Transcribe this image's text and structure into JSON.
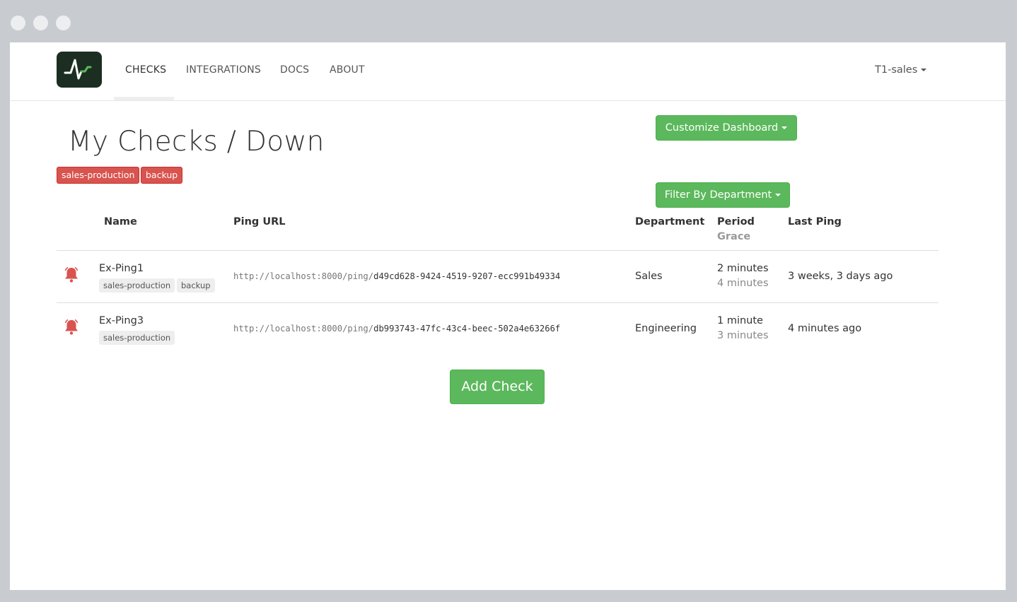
{
  "app": {
    "nav": {
      "links": [
        "CHECKS",
        "INTEGRATIONS",
        "DOCS",
        "ABOUT"
      ],
      "user": "T1-sales"
    }
  },
  "page": {
    "title": "My Checks / Down",
    "tags": [
      "sales-production",
      "backup"
    ],
    "customize_button": "Customize Dashboard",
    "filter_button": "Filter By Department",
    "add_button": "Add Check"
  },
  "table": {
    "headers": {
      "name": "Name",
      "ping_url": "Ping URL",
      "department": "Department",
      "period": "Period",
      "grace": "Grace",
      "last_ping": "Last Ping"
    },
    "rows": [
      {
        "status_icon": "bell-icon",
        "name": "Ex-Ping1",
        "tags": [
          "sales-production",
          "backup"
        ],
        "ping_base": "http://localhost:8000/ping/",
        "ping_code": "d49cd628-9424-4519-9207-ecc991b49334",
        "department": "Sales",
        "period": "2 minutes",
        "grace": "4 minutes",
        "last_ping": "3 weeks, 3 days ago"
      },
      {
        "status_icon": "bell-icon",
        "name": "Ex-Ping3",
        "tags": [
          "sales-production"
        ],
        "ping_base": "http://localhost:8000/ping/",
        "ping_code": "db993743-47fc-43c4-beec-502a4e63266f",
        "department": "Engineering",
        "period": "1 minute",
        "grace": "3 minutes",
        "last_ping": "4 minutes ago"
      }
    ]
  },
  "colors": {
    "accent_green": "#5cb85c",
    "danger_red": "#d9534f",
    "logo_bg": "#1b2e21"
  }
}
